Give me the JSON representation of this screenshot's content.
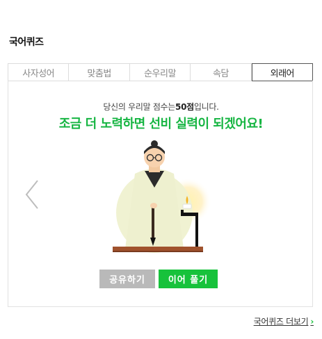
{
  "header": {
    "title": "국어퀴즈"
  },
  "tabs": [
    {
      "label": "사자성어"
    },
    {
      "label": "맞춤법"
    },
    {
      "label": "순우리말"
    },
    {
      "label": "속담"
    },
    {
      "label": "외래어"
    }
  ],
  "result": {
    "score_prefix": "당신의 우리말 점수는",
    "score_value": "50점",
    "score_suffix": "입니다.",
    "message": "조금 더 노력하면 선비 실력이 되겠어요!"
  },
  "buttons": {
    "share_label": "공유하기",
    "next_label": "이어 풀기"
  },
  "more_link": {
    "label": "국어퀴즈 더보기"
  },
  "colors": {
    "accent": "#17c23b",
    "message": "#16b542",
    "share_btn": "#b9b9b9"
  }
}
